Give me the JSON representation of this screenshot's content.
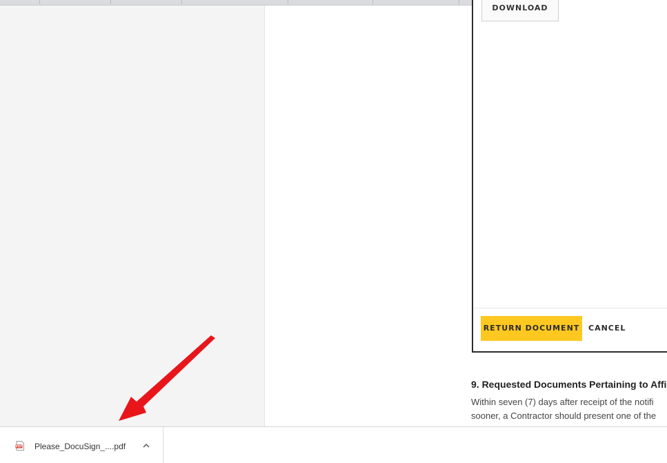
{
  "panel": {
    "download_label": "DOWNLOAD",
    "return_label": "RETURN DOCUMENT",
    "cancel_label": "CANCEL"
  },
  "document": {
    "section_title": "9. Requested Documents Pertaining to Affi",
    "lines": [
      "Within seven (7) days after receipt of the notifi",
      "sooner, a Contractor should present one of the"
    ]
  },
  "downloads": {
    "file_name": "Please_DocuSign_....pdf",
    "file_icon": "pdf-file-icon",
    "menu_icon": "chevron-up-icon"
  },
  "colors": {
    "accent": "#ffc820",
    "annotation_arrow": "#e8161b"
  }
}
